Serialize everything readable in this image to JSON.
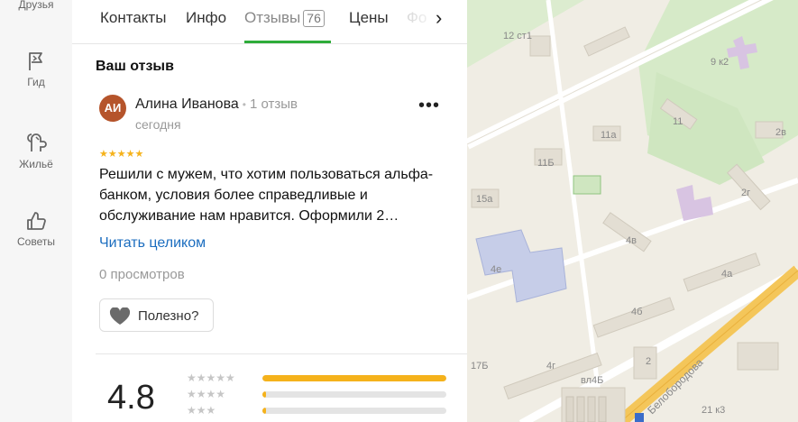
{
  "nav": {
    "items": [
      {
        "label": "Друзья",
        "icon": "friends-icon"
      },
      {
        "label": "Гид",
        "icon": "flag-icon"
      },
      {
        "label": "Жильё",
        "icon": "housing-icon"
      },
      {
        "label": "Советы",
        "icon": "thumbs-up-icon"
      }
    ]
  },
  "tabs": {
    "items": [
      {
        "label": "Контакты"
      },
      {
        "label": "Инфо"
      },
      {
        "label": "Отзывы",
        "badge": "76"
      },
      {
        "label": "Цены"
      },
      {
        "label": "Фо"
      }
    ],
    "active": "Отзывы"
  },
  "review": {
    "section_title": "Ваш отзыв",
    "avatar_initials": "АИ",
    "author": "Алина Иванова",
    "author_meta": "1 отзыв",
    "date": "сегодня",
    "stars": "★★★★★",
    "text": "Решили с мужем, что хотим пользоваться альфа-банком, условия более справедливые и обслуживание нам нравится. Оформили 2…",
    "read_more": "Читать целиком",
    "views": "0 просмотров",
    "useful_label": "Полезно?",
    "more_label": "•••"
  },
  "rating": {
    "value": "4.8",
    "rows": [
      {
        "stars": "★★★★★",
        "fraction": 1.0
      },
      {
        "stars": "★★★★",
        "fraction": 0.02
      },
      {
        "stars": "★★★",
        "fraction": 0.02
      },
      {
        "stars": "★★",
        "fraction": 0.0
      }
    ]
  },
  "map": {
    "labels": [
      "12 ст1",
      "9 к2",
      "11а",
      "11",
      "2в",
      "11Б",
      "15а",
      "2г",
      "4в",
      "4е",
      "4а",
      "4б",
      "17Б",
      "4г",
      "вл4Б",
      "2",
      "21 к3",
      "Белобородова"
    ]
  },
  "colors": {
    "accent_green": "#2eac3a",
    "star": "#f5b21b",
    "link": "#1b6dbf",
    "avatar": "#b5542b"
  }
}
